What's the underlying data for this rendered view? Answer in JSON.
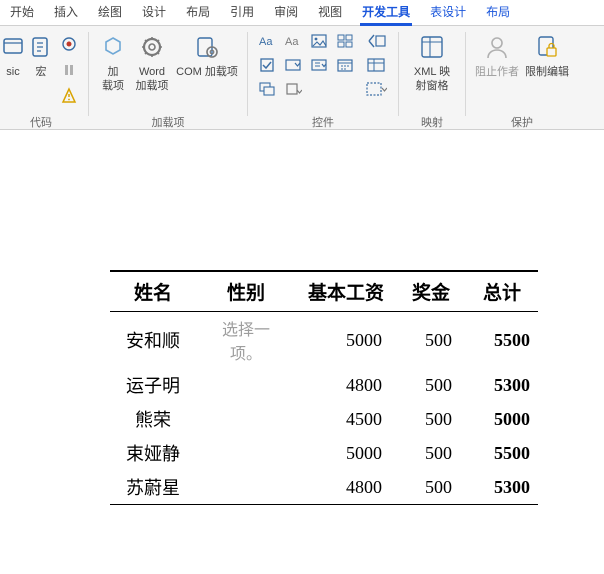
{
  "tabs": {
    "items": [
      {
        "label": "开始"
      },
      {
        "label": "插入"
      },
      {
        "label": "绘图"
      },
      {
        "label": "设计"
      },
      {
        "label": "布局"
      },
      {
        "label": "引用"
      },
      {
        "label": "审阅"
      },
      {
        "label": "视图"
      },
      {
        "label": "开发工具",
        "active": true
      },
      {
        "label": "表设计",
        "ctx": true
      },
      {
        "label": "布局",
        "ctx": true
      }
    ]
  },
  "ribbon": {
    "code_group_label": "代码",
    "basic_label": "sic",
    "macro_label": "宏",
    "addins_group_label": "加载项",
    "addins_label": "加\n载项",
    "word_addins_label": "Word\n加载项",
    "com_addins_label": "COM 加载项",
    "controls_group_label": "控件",
    "mapping_group_label": "映射",
    "xml_mapping_label": "XML 映\n射窗格",
    "protect_group_label": "保护",
    "block_authors_label": "阻止作者",
    "restrict_edit_label": "限制编辑"
  },
  "table": {
    "headers": {
      "name": "姓名",
      "gender": "性别",
      "base": "基本工资",
      "bonus": "奖金",
      "total": "总计"
    },
    "placeholder": "选择一项。",
    "rows": [
      {
        "name": "安和顺",
        "gender": "",
        "base": "5000",
        "bonus": "500",
        "total": "5500"
      },
      {
        "name": "运子明",
        "gender": "",
        "base": "4800",
        "bonus": "500",
        "total": "5300"
      },
      {
        "name": "熊荣",
        "gender": "",
        "base": "4500",
        "bonus": "500",
        "total": "5000"
      },
      {
        "name": "束娅静",
        "gender": "",
        "base": "5000",
        "bonus": "500",
        "total": "5500"
      },
      {
        "name": "苏蔚星",
        "gender": "",
        "base": "4800",
        "bonus": "500",
        "total": "5300"
      }
    ]
  }
}
